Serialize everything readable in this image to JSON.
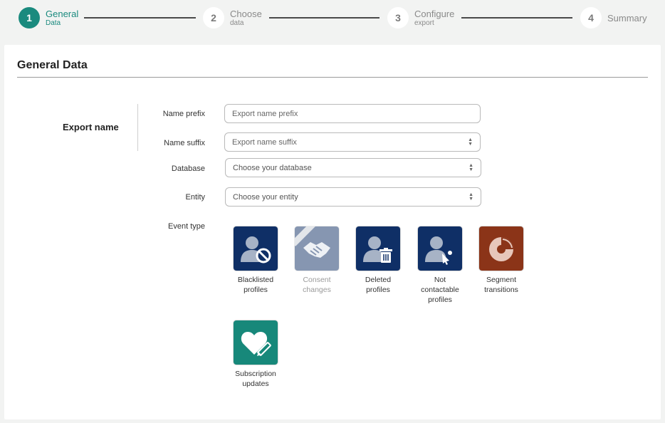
{
  "stepper": {
    "steps": [
      {
        "number": "1",
        "title": "General",
        "subtitle": "Data"
      },
      {
        "number": "2",
        "title": "Choose",
        "subtitle": "data"
      },
      {
        "number": "3",
        "title": "Configure",
        "subtitle": "export"
      },
      {
        "number": "4",
        "title": "Summary",
        "subtitle": ""
      }
    ],
    "active_color": "#1a8a7e"
  },
  "card": {
    "title": "General Data",
    "section_label": "Export name"
  },
  "form": {
    "name_prefix": {
      "label": "Name prefix",
      "placeholder": "Export name prefix",
      "value": ""
    },
    "name_suffix": {
      "label": "Name suffix",
      "placeholder": "Export name suffix",
      "value": ""
    },
    "database": {
      "label": "Database",
      "value": "Choose your database"
    },
    "entity": {
      "label": "Entity",
      "value": "Choose your entity"
    },
    "event_type_label": "Event type"
  },
  "event_types": [
    {
      "label_1": "Blacklisted",
      "label_2": "profiles",
      "label_3": "",
      "icon": "blacklisted-profile-icon",
      "color": "#0f2f66"
    },
    {
      "label_1": "Consent",
      "label_2": "changes",
      "label_3": "",
      "icon": "handshake-icon",
      "color": "#0f2f66",
      "disabled": true
    },
    {
      "label_1": "Deleted",
      "label_2": "profiles",
      "label_3": "",
      "icon": "deleted-profile-icon",
      "color": "#0f2f66"
    },
    {
      "label_1": "Not",
      "label_2": "contactable",
      "label_3": "profiles",
      "icon": "not-contactable-profile-icon",
      "color": "#0f2f66"
    },
    {
      "label_1": "Segment",
      "label_2": "transitions",
      "label_3": "",
      "icon": "segment-pie-icon",
      "color": "#8b3418"
    },
    {
      "label_1": "Subscription",
      "label_2": "updates",
      "label_3": "",
      "icon": "heart-edit-icon",
      "color": "#17887a"
    }
  ]
}
